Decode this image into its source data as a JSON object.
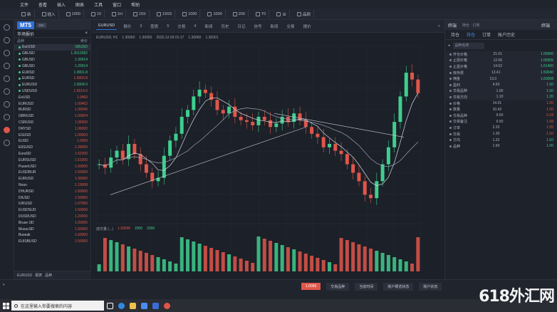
{
  "menu": [
    "文件",
    "查看",
    "插入",
    "图表",
    "工具",
    "窗口",
    "帮助"
  ],
  "toolbar": [
    "新",
    "插入",
    "1000",
    "10",
    "1H",
    "15S",
    "1S5S",
    "1000",
    "1000",
    "200",
    "T0",
    "ㄓ",
    "品颜"
  ],
  "watch": {
    "brand": "MT5",
    "brand_sub": "360",
    "title": "市场报价",
    "head": [
      "品种",
      "卖价"
    ],
    "symbols": [
      {
        "n": "EurUSD",
        "v": "GBUSD",
        "c": "up"
      },
      {
        "n": "GBUSD",
        "v": "1.3012082",
        "c": "up"
      },
      {
        "n": "GBUSD",
        "v": "1.30014",
        "c": "up"
      },
      {
        "n": "GBUSD",
        "v": "1.20014",
        "c": "up"
      },
      {
        "n": "EURSD",
        "v": "1.9001.8",
        "c": "up"
      },
      {
        "n": "EURSD",
        "v": "1.9003.8",
        "c": "dn"
      },
      {
        "n": "EURUSD",
        "v": "1.5004.0",
        "c": "up"
      },
      {
        "n": "USDUSD",
        "v": "1.5614.0",
        "c": "dn"
      },
      {
        "n": "ExUSD",
        "v": "1.0460",
        "c": "dn"
      },
      {
        "n": "EURUSD",
        "v": "1.00462",
        "c": "dn"
      },
      {
        "n": "BURSD",
        "v": "1.00040",
        "c": "dn"
      },
      {
        "n": "GBRUSD",
        "v": "1.00004",
        "c": "dn"
      },
      {
        "n": "CSRUSD",
        "v": "1.06600",
        "c": "dn"
      },
      {
        "n": "DRYSD",
        "v": "1.06000",
        "c": "dn"
      },
      {
        "n": "ESUSD",
        "v": "1.00003",
        "c": "dn"
      },
      {
        "n": "EUSD",
        "v": "1.0000",
        "c": "dn"
      },
      {
        "n": "E6SUSD",
        "v": "1.26000",
        "c": "dn"
      },
      {
        "n": "EuraSD",
        "v": "1.52200",
        "c": "dn"
      },
      {
        "n": "EURSUSD",
        "v": "1.61000",
        "c": "dn"
      },
      {
        "n": "PusenUSD",
        "v": "1.60000",
        "c": "dn"
      },
      {
        "n": "EUSDBUR",
        "v": "1.50000",
        "c": "dn"
      },
      {
        "n": "EURUSD",
        "v": "1.00060",
        "c": "dn"
      },
      {
        "n": "Noun",
        "v": "1.15008",
        "c": "dn"
      },
      {
        "n": "DHURSD",
        "v": "1.60000",
        "c": "dn"
      },
      {
        "n": "DIUSD",
        "v": "1.50000",
        "c": "dn"
      },
      {
        "n": "IURUSD",
        "v": "1.07000",
        "c": "dn"
      },
      {
        "n": "EUSDSUD",
        "v": "1.50000",
        "c": "dn"
      },
      {
        "n": "DUSDUSD",
        "v": "1.20000",
        "c": "dn"
      },
      {
        "n": "Bruse UD",
        "v": "1.00005",
        "c": "dn"
      },
      {
        "n": "MusucSD",
        "v": "1.50000",
        "c": "dn"
      },
      {
        "n": "Buseak",
        "v": "1.60000",
        "c": "dn"
      },
      {
        "n": "EUISBUSD",
        "v": "1.50050",
        "c": "dn"
      }
    ],
    "bottom": [
      "EURUSD",
      "报表",
      "品种"
    ]
  },
  "chart": {
    "tabs": [
      "EURUSD",
      "报价",
      "3",
      "图表",
      "5",
      "交易",
      "4",
      "新闻",
      "历史",
      "日记",
      "信号",
      "新闻",
      "交易",
      "报价"
    ],
    "info": [
      "EURUSD, H1",
      "1.30060",
      "1.30050",
      "2020.12.09 01:17",
      "1.30060",
      "1.30001"
    ],
    "sub_info": [
      "成交量 (...)",
      "1.30098",
      "2000",
      "2000"
    ]
  },
  "chart_data": {
    "type": "line",
    "title": "",
    "ylim": [
      0,
      100
    ],
    "price": [
      30,
      28,
      34,
      38,
      33,
      42,
      36,
      30,
      25,
      20,
      22,
      35,
      44,
      48,
      58,
      62,
      70,
      74,
      72,
      68,
      62,
      60,
      64,
      58,
      56,
      55,
      53,
      58,
      56,
      52,
      54,
      58,
      55,
      60,
      56,
      52,
      48,
      46,
      40,
      42,
      38,
      36,
      30,
      25,
      20,
      12,
      10,
      20,
      30,
      40,
      55,
      70,
      84,
      80,
      72
    ]
  },
  "right_panel": {
    "title": "终端",
    "sub": "持仓 · 订单",
    "tab_main": "终端",
    "tabs": [
      "持仓",
      "持仓",
      "订单",
      "账户历史"
    ],
    "search": "品种名称",
    "rows": [
      {
        "k": "开仓价格",
        "m": "21.01",
        "v": "1.05500",
        "c": "up"
      },
      {
        "k": "止损价格",
        "m": "12.06",
        "v": "1.05505",
        "c": "up"
      },
      {
        "k": "止盈价格",
        "m": "14.02",
        "v": "1.61400",
        "c": "up"
      },
      {
        "k": "库存费",
        "m": "13.41",
        "v": "1.50040",
        "c": "up"
      },
      {
        "k": "佣金",
        "m": "13.0",
        "v": "1.63008",
        "c": "up"
      },
      {
        "k": "盈利",
        "m": "4.50",
        "v": "1.50",
        "c": "up"
      },
      {
        "k": "交易品种",
        "m": "1.00",
        "v": "1.00",
        "c": "up"
      },
      {
        "k": "交易方向",
        "m": "1.10",
        "v": "1.20",
        "c": "up"
      },
      {
        "k": "价格",
        "m": "14.01",
        "v": "1.00",
        "c": "dn"
      },
      {
        "k": "数量",
        "m": "10.42",
        "v": "1.00",
        "c": "dn"
      },
      {
        "k": "交易品种",
        "m": "9.00",
        "v": "0.18",
        "c": "dn"
      },
      {
        "k": "交易备注",
        "m": "6.50",
        "v": "1.08",
        "c": "dn"
      },
      {
        "k": "订单",
        "m": "2.20",
        "v": "1.55",
        "c": "dn"
      },
      {
        "k": "交易",
        "m": "1.30",
        "v": "1.50",
        "c": "dn"
      },
      {
        "k": "方向",
        "m": "1.32",
        "v": "1.50",
        "c": "up"
      },
      {
        "k": "品种",
        "m": "1.60",
        "v": "1.00",
        "c": "up"
      }
    ]
  },
  "status": {
    "items": [
      "交易品种",
      "当前时间",
      "账户概览状态",
      "账户状态"
    ],
    "red": "1.0056"
  },
  "taskbar": {
    "search": "在这里输入你要搜索的内容"
  },
  "watermark": "618外汇网"
}
